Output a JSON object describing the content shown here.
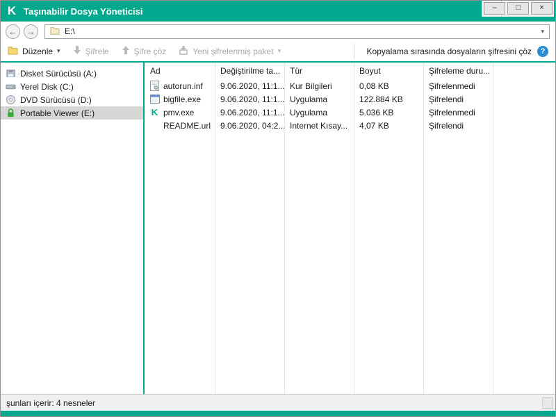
{
  "window": {
    "title": "Taşınabilir Dosya Yöneticisi",
    "controls": {
      "minimize": "–",
      "maximize": "□",
      "close": "×"
    }
  },
  "icons": {
    "back": "←",
    "forward": "→",
    "caret": "▾",
    "chevron": "▾",
    "help": "?",
    "k_logo": "K"
  },
  "colors": {
    "accent_teal": "#00a88e",
    "selected_row": "#d6d6d6",
    "help_blue": "#2a8dd4",
    "lock_green": "#37a93c",
    "folder_yellow": "#f9d870"
  },
  "nav": {
    "address": "E:\\"
  },
  "toolbar": {
    "items": [
      {
        "label": "Düzenle",
        "enabled": true
      },
      {
        "label": "Şifrele",
        "enabled": false
      },
      {
        "label": "Şifre çöz",
        "enabled": false
      },
      {
        "label": "Yeni şifrelenmiş paket",
        "enabled": false
      }
    ],
    "note": "Kopyalama sırasında dosyaların şifresini çöz"
  },
  "sidebar": {
    "items": [
      {
        "label": "Disket Sürücüsü (A:)",
        "icon": "floppy-drive-icon",
        "selected": false
      },
      {
        "label": "Yerel Disk (C:)",
        "icon": "hard-disk-icon",
        "selected": false
      },
      {
        "label": "DVD Sürücüsü (D:)",
        "icon": "dvd-drive-icon",
        "selected": false
      },
      {
        "label": "Portable Viewer (E:)",
        "icon": "lock-icon",
        "selected": true
      }
    ]
  },
  "filelist": {
    "columns": [
      "Ad",
      "Değiştirilme ta...",
      "Tür",
      "Boyut",
      "Şifreleme duru..."
    ],
    "rows": [
      {
        "name": "autorun.inf",
        "modified": "9.06.2020, 11:1...",
        "type": "Kur Bilgileri",
        "size": "0,08 KB",
        "encryption": "Şifrelenmedi"
      },
      {
        "name": "bigfile.exe",
        "modified": "9.06.2020, 11:1...",
        "type": "Uygulama",
        "size": "122.884 KB",
        "encryption": "Şifrelendi"
      },
      {
        "name": "pmv.exe",
        "modified": "9.06.2020, 11:1...",
        "type": "Uygulama",
        "size": "5.036 KB",
        "encryption": "Şifrelenmedi"
      },
      {
        "name": "README.url",
        "modified": "9.06.2020, 04:2...",
        "type": "Internet Kısay...",
        "size": "4,07 KB",
        "encryption": "Şifrelendi"
      }
    ]
  },
  "statusbar": {
    "text": "şunları içerir: 4 nesneler"
  }
}
